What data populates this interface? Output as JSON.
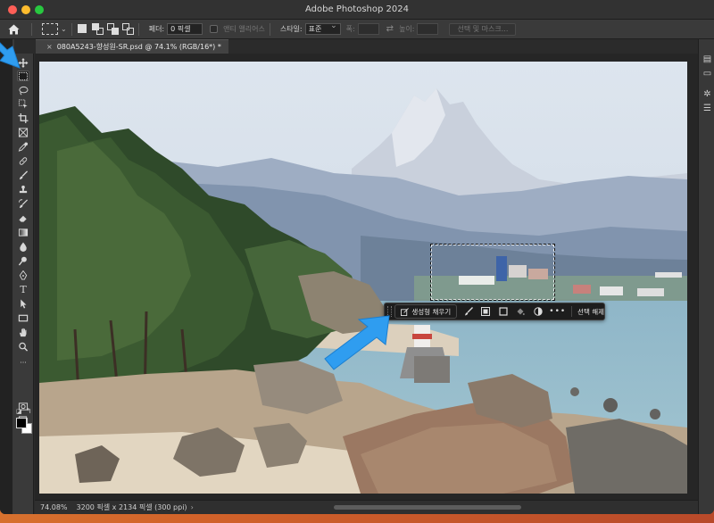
{
  "app": {
    "title": "Adobe Photoshop 2024"
  },
  "options_bar": {
    "feather_label": "페더:",
    "feather_value": "0 픽셀",
    "anti_alias_label": "앤티 앨리어스",
    "style_label": "스타일:",
    "style_value": "표준",
    "width_label": "폭:",
    "height_label": "높이:",
    "select_and_mask_label": "선택 및 마스크..."
  },
  "document": {
    "tab_title": "080A5243-향성원-SR.psd @ 74.1% (RGB/16*) *",
    "close_glyph": "×"
  },
  "toolbar": {
    "collapse_glyph": "»",
    "tools": [
      {
        "name": "move-tool",
        "icon": "move-icon"
      },
      {
        "name": "rectangular-marquee-tool",
        "icon": "marquee-icon",
        "active": true
      },
      {
        "name": "lasso-tool",
        "icon": "lasso-icon"
      },
      {
        "name": "object-selection-tool",
        "icon": "object-select-icon"
      },
      {
        "name": "crop-tool",
        "icon": "crop-icon"
      },
      {
        "name": "frame-tool",
        "icon": "frame-icon"
      },
      {
        "name": "eyedropper-tool",
        "icon": "eyedropper-icon"
      },
      {
        "name": "spot-healing-tool",
        "icon": "healing-icon"
      },
      {
        "name": "brush-tool",
        "icon": "brush-icon"
      },
      {
        "name": "clone-stamp-tool",
        "icon": "stamp-icon"
      },
      {
        "name": "history-brush-tool",
        "icon": "history-brush-icon"
      },
      {
        "name": "eraser-tool",
        "icon": "eraser-icon"
      },
      {
        "name": "gradient-tool",
        "icon": "gradient-icon"
      },
      {
        "name": "blur-tool",
        "icon": "blur-icon"
      },
      {
        "name": "dodge-tool",
        "icon": "dodge-icon"
      },
      {
        "name": "pen-tool",
        "icon": "pen-icon"
      },
      {
        "name": "type-tool",
        "icon": "type-icon"
      },
      {
        "name": "path-selection-tool",
        "icon": "arrow-icon"
      },
      {
        "name": "rectangle-tool",
        "icon": "rectangle-icon"
      },
      {
        "name": "hand-tool",
        "icon": "hand-icon"
      },
      {
        "name": "zoom-tool",
        "icon": "zoom-icon"
      },
      {
        "name": "edit-toolbar",
        "icon": "more-icon"
      }
    ],
    "type_glyph": "T",
    "more_glyph": "···"
  },
  "contextual_taskbar": {
    "generative_fill_label": "생성형 채우기",
    "more_glyph": "•••",
    "deselect_label": "선택 해제"
  },
  "status": {
    "zoom": "74.08%",
    "doc_info": "3200 픽셀 x 2134 픽셀 (300 ppi)",
    "arrow_glyph": "›"
  },
  "colors": {
    "foreground": "#000000",
    "background": "#ffffff",
    "tutorial_arrow": "#2f9df0"
  }
}
